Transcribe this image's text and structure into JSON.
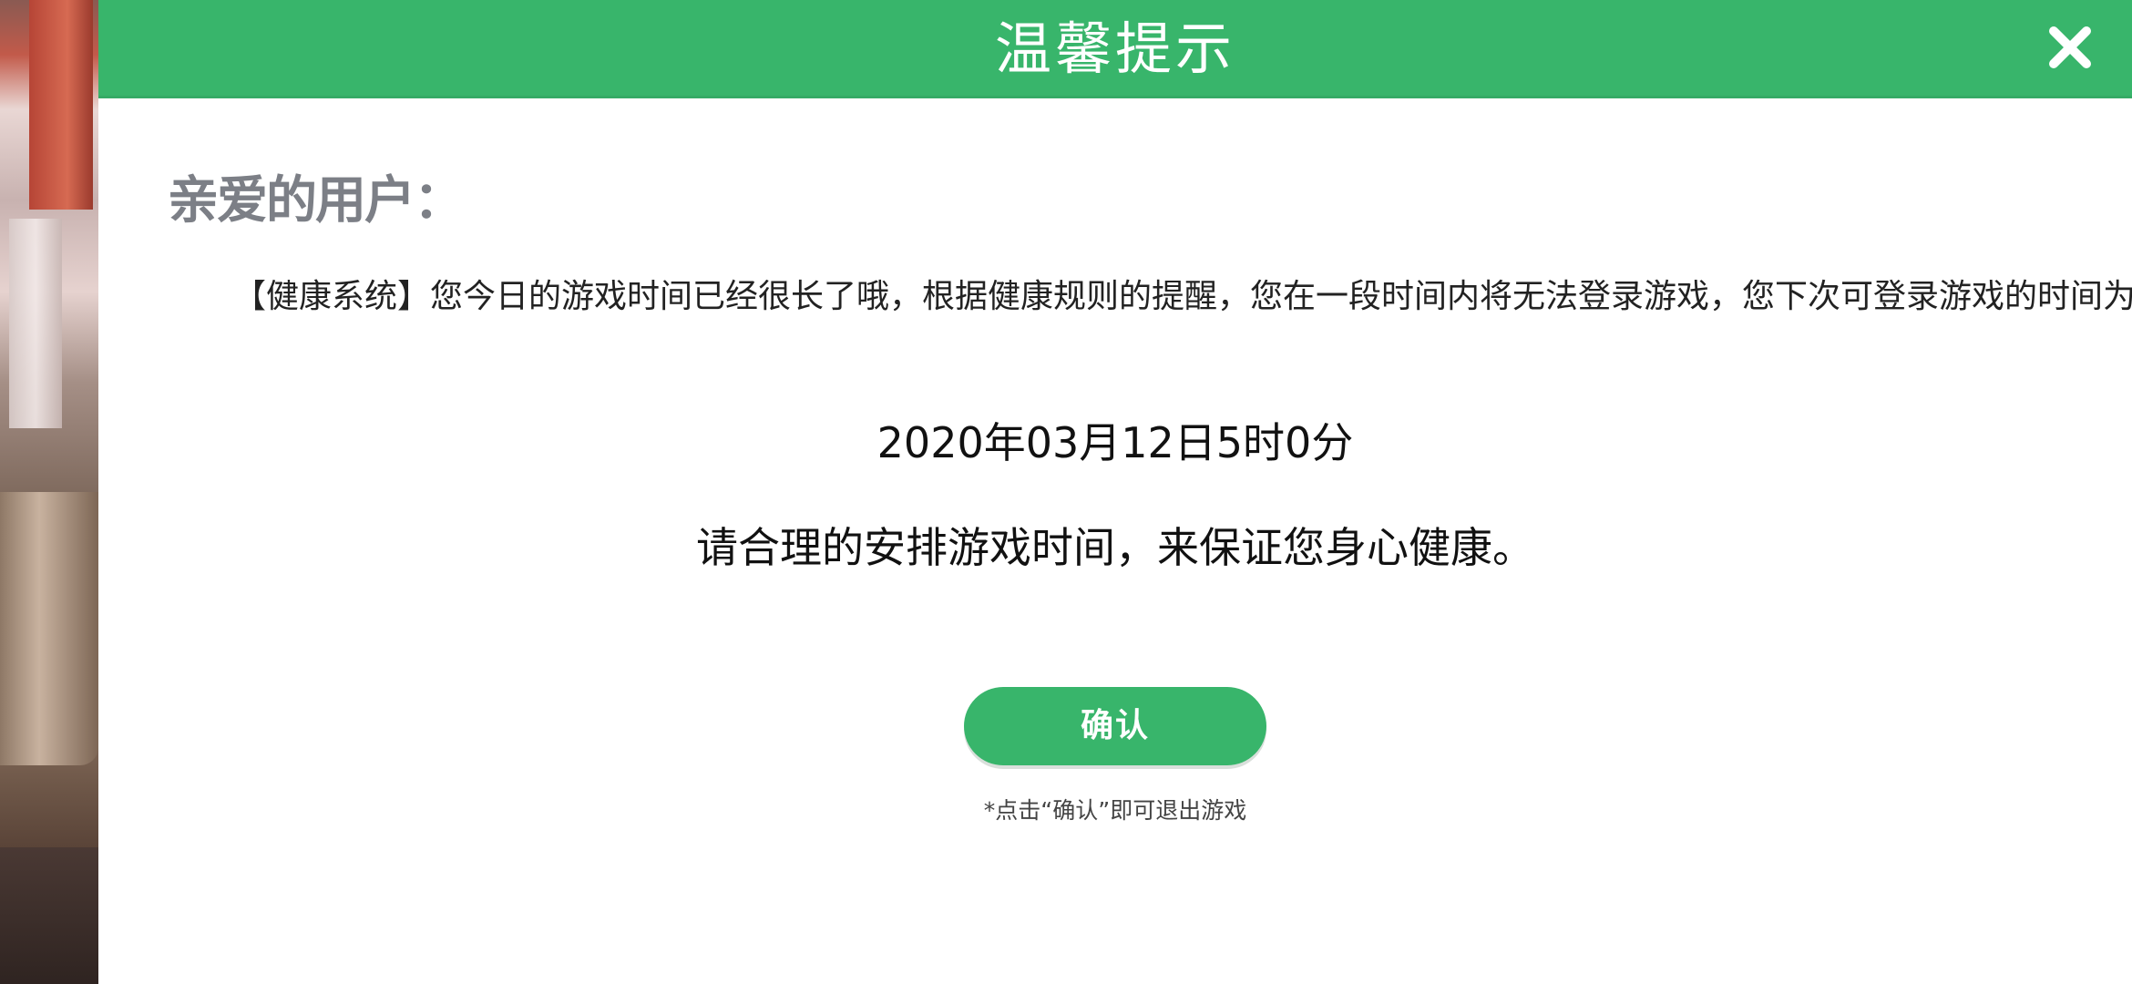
{
  "dialog": {
    "title": "温馨提示",
    "greeting": "亲爱的用户：",
    "message": "【健康系统】您今日的游戏时间已经很长了哦，根据健康规则的提醒，您在一段时间内将无法登录游戏，您下次可登录游戏的时间为",
    "next_login_time": "2020年03月12日5时0分",
    "advice": "请合理的安排游戏时间，来保证您身心健康。",
    "confirm_label": "确认",
    "hint": "*点击“确认”即可退出游戏"
  },
  "icons": {
    "close": "close-icon"
  },
  "colors": {
    "accent": "#38b56b",
    "greeting": "#7c7f86",
    "text": "#222222"
  }
}
